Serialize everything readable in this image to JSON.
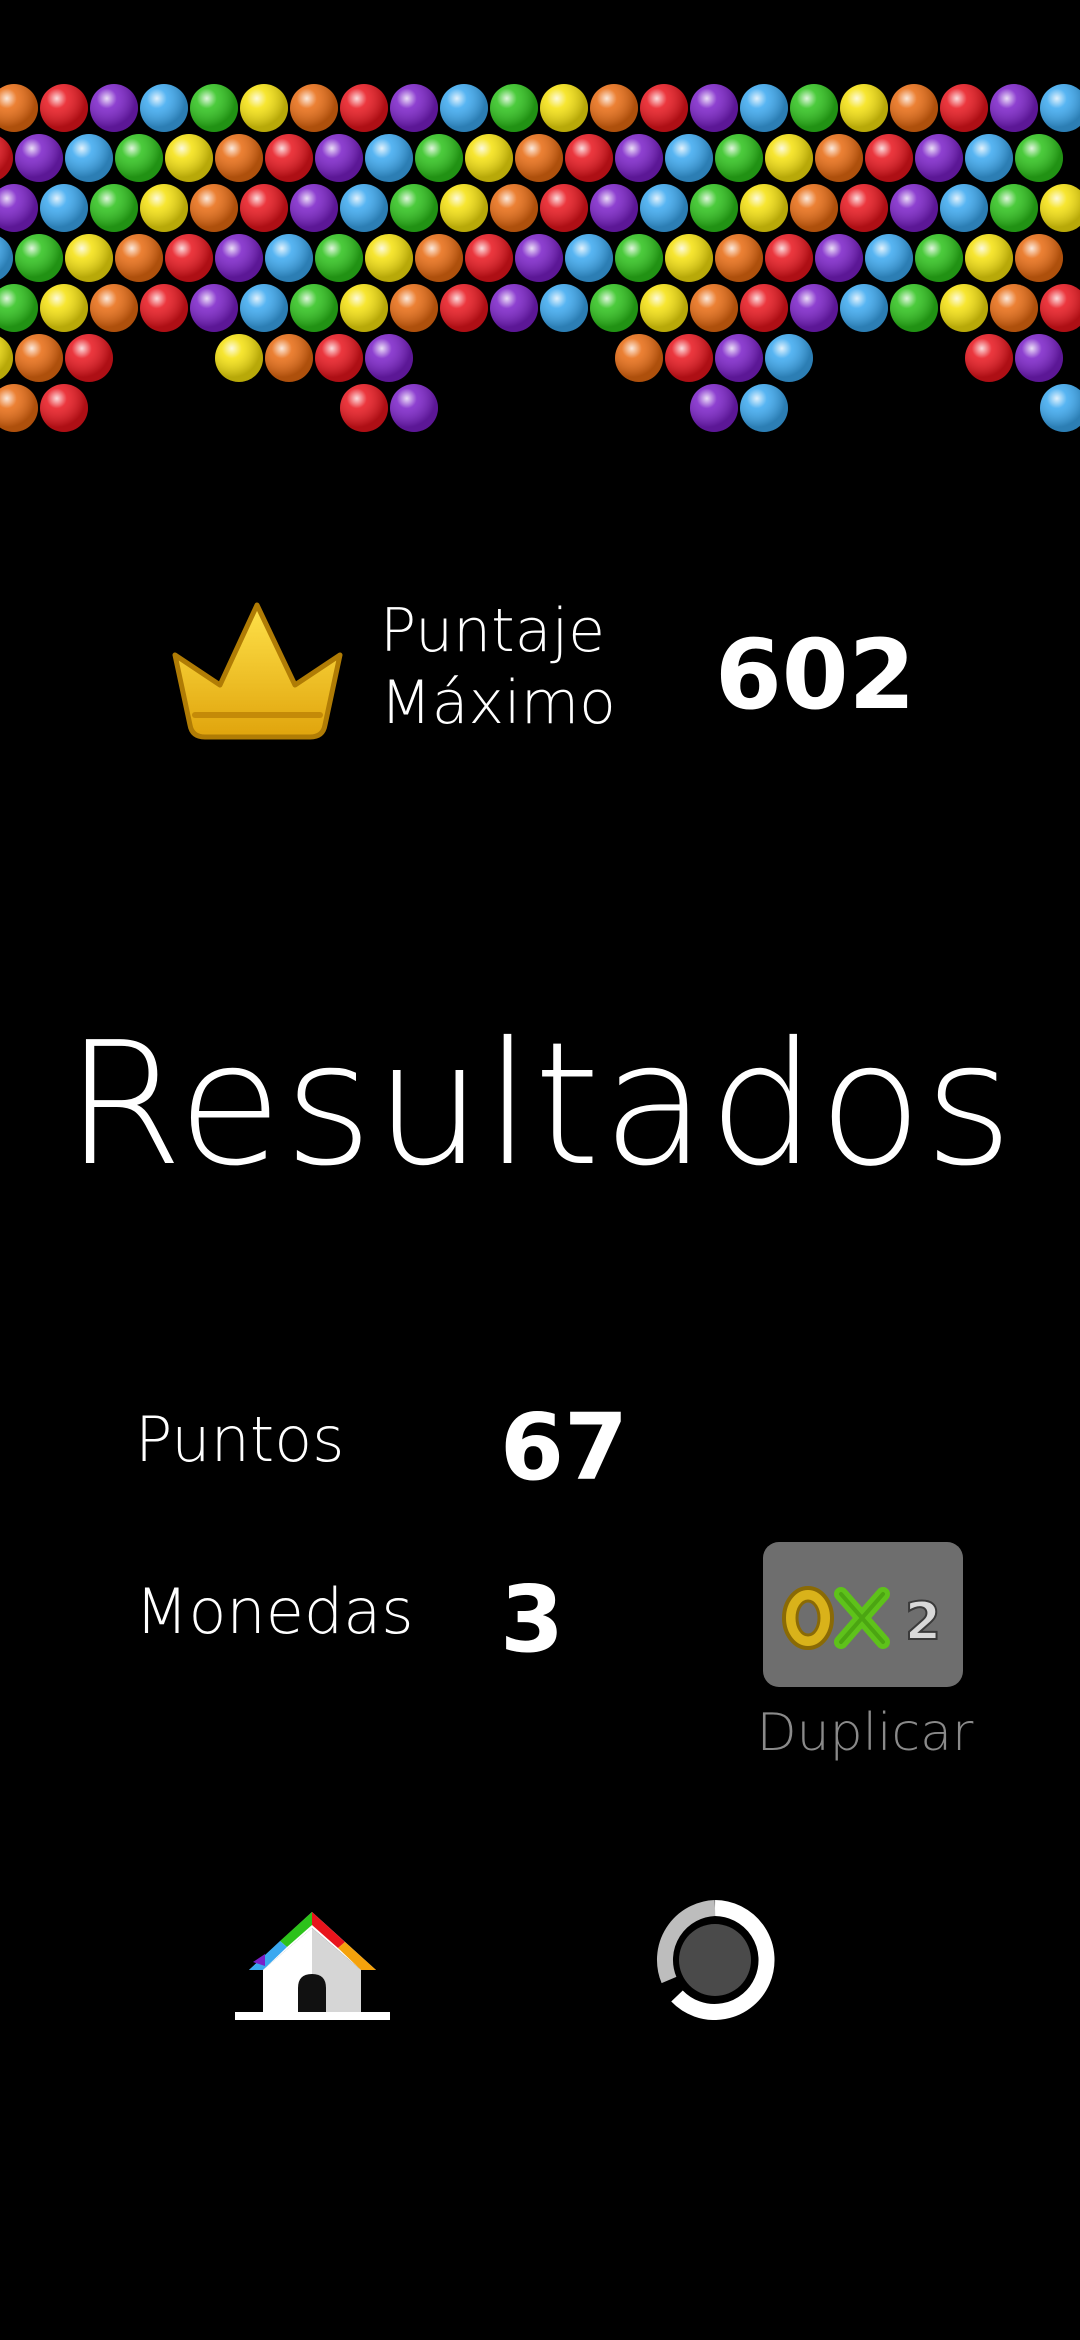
{
  "header": {
    "highscore_label_line1": "Puntaje",
    "highscore_label_line2": "Máximo",
    "highscore_value": "602"
  },
  "results": {
    "title": "Resultados",
    "points_label": "Puntos",
    "points_value": "67",
    "coins_label": "Monedas",
    "coins_value": "3"
  },
  "double_button": {
    "multiplier": "2",
    "label": "Duplicar"
  },
  "icons": {
    "crown": "crown-icon",
    "home": "home-icon",
    "replay": "replay-icon",
    "coin": "coin-icon"
  },
  "colors": {
    "background": "#000000",
    "bubble_red": "#e8141c",
    "bubble_orange": "#e86a10",
    "bubble_yellow": "#f5e10c",
    "bubble_green": "#2cc21a",
    "bubble_blue": "#3aa8f0",
    "bubble_purple": "#7a1fc8",
    "crown_gold": "#f2c21a"
  },
  "bubble_rows": [
    [
      "orange",
      "red",
      "purple",
      "blue",
      "green",
      "yellow",
      "orange",
      "red",
      "purple",
      "blue",
      "green",
      "yellow",
      "orange",
      "red",
      "purple",
      "blue",
      "green",
      "yellow",
      "orange",
      "red",
      "purple",
      "blue"
    ],
    [
      "red",
      "purple",
      "blue",
      "green",
      "yellow",
      "orange",
      "red",
      "purple",
      "blue",
      "green",
      "yellow",
      "orange",
      "red",
      "purple",
      "blue",
      "green",
      "yellow",
      "orange",
      "red",
      "purple",
      "blue",
      "green"
    ],
    [
      "purple",
      "blue",
      "green",
      "yellow",
      "orange",
      "red",
      "purple",
      "blue",
      "green",
      "yellow",
      "orange",
      "red",
      "purple",
      "blue",
      "green",
      "yellow",
      "orange",
      "red",
      "purple",
      "blue",
      "green",
      "yellow"
    ],
    [
      "blue",
      "green",
      "yellow",
      "orange",
      "red",
      "purple",
      "blue",
      "green",
      "yellow",
      "orange",
      "red",
      "purple",
      "blue",
      "green",
      "yellow",
      "orange",
      "red",
      "purple",
      "blue",
      "green",
      "yellow",
      "orange"
    ],
    [
      "green",
      "yellow",
      "orange",
      "red",
      "purple",
      "blue",
      "green",
      "yellow",
      "orange",
      "red",
      "purple",
      "blue",
      "green",
      "yellow",
      "orange",
      "red",
      "purple",
      "blue",
      "green",
      "yellow",
      "orange",
      "red"
    ],
    [
      "yellow",
      "orange",
      "red",
      "",
      "",
      "yellow",
      "orange",
      "red",
      "purple",
      "",
      "",
      "",
      "",
      "orange",
      "red",
      "purple",
      "blue",
      "",
      "",
      "",
      "red",
      "purple"
    ],
    [
      "orange",
      "red",
      "",
      "",
      "",
      "",
      "",
      "red",
      "purple",
      "",
      "",
      "",
      "",
      "",
      "purple",
      "blue",
      "",
      "",
      "",
      "",
      "",
      "blue"
    ]
  ]
}
